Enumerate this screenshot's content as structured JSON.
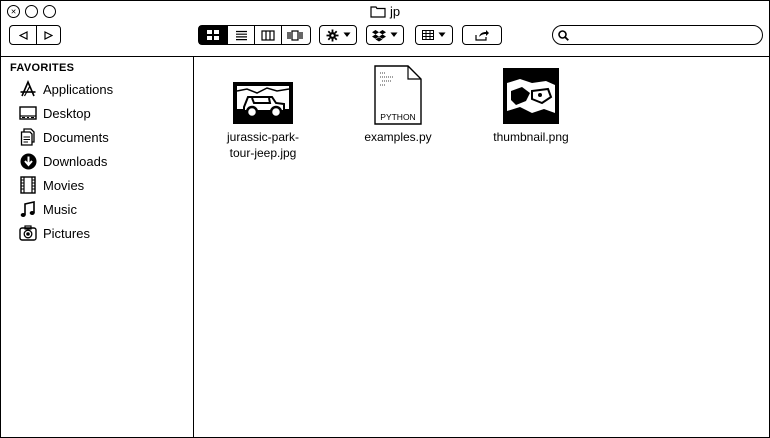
{
  "window": {
    "title": "jp"
  },
  "toolbar": {
    "view_modes": [
      "icon-view",
      "list-view",
      "column-view",
      "coverflow-view"
    ],
    "selected_view": "icon-view",
    "search": {
      "value": "",
      "placeholder": ""
    }
  },
  "sidebar": {
    "section_title": "FAVORITES",
    "items": [
      {
        "label": "Applications",
        "icon": "applications-icon"
      },
      {
        "label": "Desktop",
        "icon": "desktop-icon"
      },
      {
        "label": "Documents",
        "icon": "documents-icon"
      },
      {
        "label": "Downloads",
        "icon": "downloads-icon"
      },
      {
        "label": "Movies",
        "icon": "movies-icon"
      },
      {
        "label": "Music",
        "icon": "music-icon"
      },
      {
        "label": "Pictures",
        "icon": "pictures-icon"
      }
    ]
  },
  "files": [
    {
      "name_line1": "jurassic-park-",
      "name_line2": "tour-jeep.jpg",
      "type": "image"
    },
    {
      "name_line1": "examples.py",
      "name_line2": "",
      "type": "python",
      "badge": "PYTHON"
    },
    {
      "name_line1": "thumbnail.png",
      "name_line2": "",
      "type": "image"
    }
  ]
}
